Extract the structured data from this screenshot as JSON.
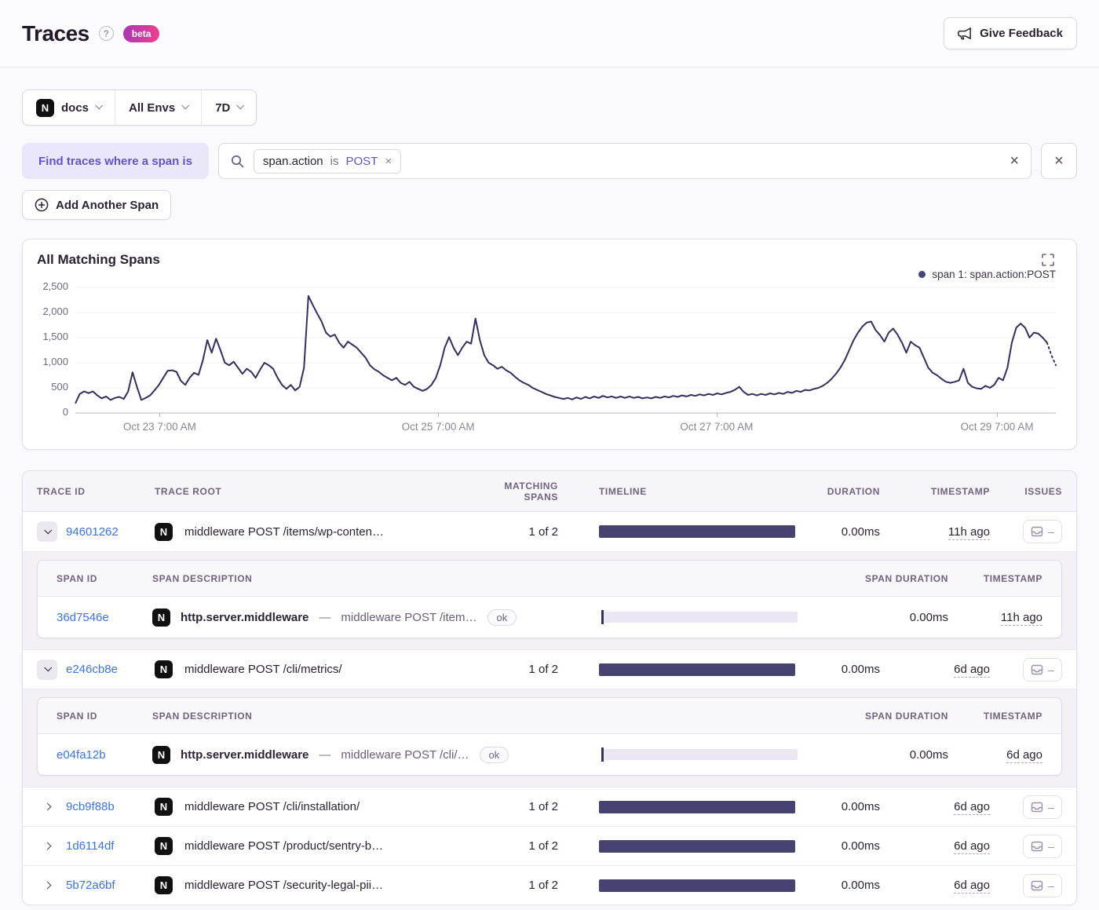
{
  "header": {
    "title": "Traces",
    "beta_label": "beta",
    "feedback_label": "Give Feedback"
  },
  "icons": {
    "close": "×",
    "help": "?",
    "nextjs": "N",
    "dash": "–"
  },
  "filter_bar": {
    "project_label": "docs",
    "env_label": "All Envs",
    "period_label": "7D"
  },
  "query_builder": {
    "chip_label": "Find traces where a span is",
    "token_key": "span.action",
    "token_op": "is",
    "token_value": "POST",
    "add_button_label": "Add Another Span"
  },
  "chart": {
    "title": "All Matching Spans",
    "legend_label": "span 1: span.action:POST",
    "chart_data": {
      "type": "line",
      "title": "All Matching Spans",
      "xlabel": "",
      "ylabel": "",
      "ylim": [
        0,
        2500
      ],
      "grid": "horizontal",
      "legend_position": "top-right",
      "y_ticks": [
        0,
        500,
        1000,
        1500,
        2000,
        2500
      ],
      "y_tick_labels": [
        "0",
        "500",
        "1,000",
        "1,500",
        "2,000",
        "2,500"
      ],
      "x_ticks": [
        {
          "label": "Oct 23 7:00 AM",
          "pos": 0.086
        },
        {
          "label": "Oct 25 7:00 AM",
          "pos": 0.37
        },
        {
          "label": "Oct 27 7:00 AM",
          "pos": 0.654
        },
        {
          "label": "Oct 29 7:00 AM",
          "pos": 0.94
        }
      ],
      "dotted_tail_points": 3,
      "series": [
        {
          "name": "span 1: span.action:POST",
          "values": [
            190,
            380,
            430,
            395,
            430,
            350,
            290,
            330,
            260,
            300,
            320,
            280,
            430,
            810,
            520,
            260,
            300,
            350,
            450,
            560,
            700,
            840,
            850,
            820,
            640,
            560,
            700,
            800,
            760,
            1050,
            1450,
            1200,
            1480,
            1250,
            1000,
            950,
            1020,
            900,
            780,
            880,
            820,
            700,
            860,
            1000,
            950,
            880,
            700,
            560,
            480,
            560,
            450,
            520,
            900,
            2330,
            2150,
            1980,
            1820,
            1600,
            1520,
            1560,
            1400,
            1300,
            1420,
            1360,
            1300,
            1200,
            1100,
            950,
            870,
            820,
            750,
            700,
            650,
            700,
            600,
            560,
            620,
            520,
            480,
            440,
            480,
            560,
            700,
            950,
            1300,
            1510,
            1300,
            1150,
            1300,
            1420,
            1380,
            1880,
            1450,
            1150,
            1000,
            950,
            880,
            920,
            850,
            800,
            720,
            650,
            600,
            560,
            500,
            460,
            420,
            380,
            350,
            320,
            300,
            280,
            300,
            270,
            310,
            280,
            320,
            290,
            330,
            300,
            340,
            310,
            330,
            300,
            330,
            300,
            330,
            300,
            320,
            290,
            310,
            290,
            320,
            300,
            330,
            310,
            340,
            320,
            350,
            330,
            360,
            340,
            370,
            350,
            380,
            360,
            390,
            370,
            400,
            420,
            460,
            520,
            420,
            360,
            380,
            350,
            380,
            360,
            390,
            370,
            400,
            380,
            420,
            400,
            440,
            420,
            460,
            450,
            480,
            500,
            540,
            600,
            680,
            780,
            900,
            1050,
            1250,
            1450,
            1600,
            1720,
            1800,
            1820,
            1650,
            1550,
            1420,
            1600,
            1680,
            1560,
            1400,
            1200,
            1420,
            1350,
            1300,
            1100,
            900,
            800,
            750,
            680,
            620,
            600,
            620,
            650,
            880,
            600,
            520,
            490,
            480,
            540,
            500,
            560,
            700,
            650,
            900,
            1400,
            1700,
            1780,
            1700,
            1500,
            1600,
            1580,
            1500,
            1400,
            1150,
            950
          ]
        }
      ]
    }
  },
  "trace_table": {
    "columns": [
      "Trace ID",
      "Trace Root",
      "Matching Spans",
      "Timeline",
      "Duration",
      "Timestamp",
      "Issues"
    ],
    "span_columns": [
      "Span ID",
      "Span Description",
      "Span Duration",
      "Timestamp"
    ],
    "rows": [
      {
        "trace_id": "94601262",
        "expanded": true,
        "root": "middleware POST /items/wp-conten…",
        "matching_spans": "1 of 2",
        "duration": "0.00ms",
        "timestamp": "11h ago",
        "spans": [
          {
            "span_id": "36d7546e",
            "op": "http.server.middleware",
            "separator": "—",
            "description": "middleware POST /item…",
            "status": "ok",
            "duration": "0.00ms",
            "timestamp": "11h ago"
          }
        ]
      },
      {
        "trace_id": "e246cb8e",
        "expanded": true,
        "root": "middleware POST /cli/metrics/",
        "matching_spans": "1 of 2",
        "duration": "0.00ms",
        "timestamp": "6d ago",
        "spans": [
          {
            "span_id": "e04fa12b",
            "op": "http.server.middleware",
            "separator": "—",
            "description": "middleware POST /cli/…",
            "status": "ok",
            "duration": "0.00ms",
            "timestamp": "6d ago"
          }
        ]
      },
      {
        "trace_id": "9cb9f88b",
        "expanded": false,
        "root": "middleware POST /cli/installation/",
        "matching_spans": "1 of 2",
        "duration": "0.00ms",
        "timestamp": "6d ago",
        "spans": []
      },
      {
        "trace_id": "1d6114df",
        "expanded": false,
        "root": "middleware POST /product/sentry-b…",
        "matching_spans": "1 of 2",
        "duration": "0.00ms",
        "timestamp": "6d ago",
        "spans": []
      },
      {
        "trace_id": "5b72a6bf",
        "expanded": false,
        "root": "middleware POST /security-legal-pii…",
        "matching_spans": "1 of 2",
        "duration": "0.00ms",
        "timestamp": "6d ago",
        "spans": []
      }
    ]
  },
  "colors": {
    "accent_purple": "#6254c7",
    "link_blue": "#3d74db",
    "chart_line": "#362e5c",
    "legend_dot": "#444674",
    "timeline_bar": "#474370",
    "mini_bar": "#eae6f2",
    "beta_gradient_start": "#a737b4",
    "beta_gradient_end": "#f0408e"
  }
}
